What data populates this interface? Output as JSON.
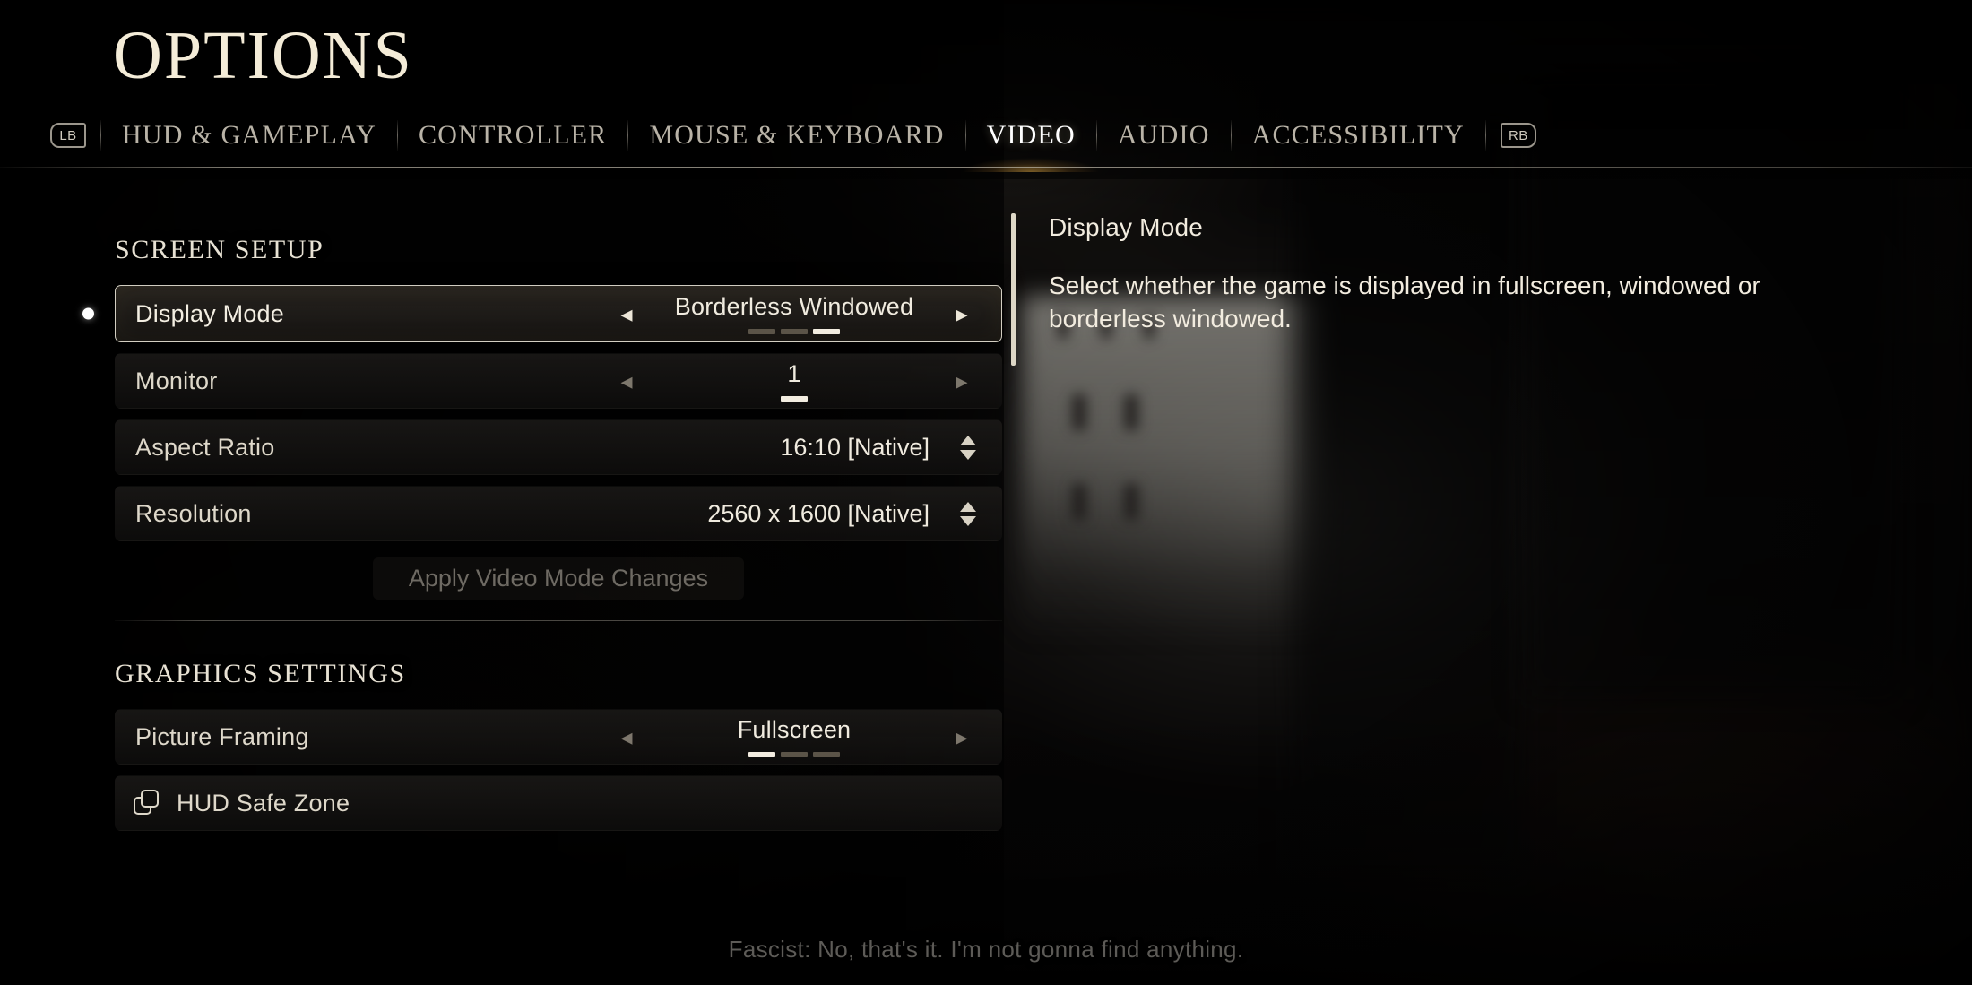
{
  "header": {
    "title": "OPTIONS",
    "bumper_left": "LB",
    "bumper_right": "RB",
    "tabs": [
      {
        "label": "HUD & GAMEPLAY",
        "active": false
      },
      {
        "label": "CONTROLLER",
        "active": false
      },
      {
        "label": "MOUSE & KEYBOARD",
        "active": false
      },
      {
        "label": "VIDEO",
        "active": true
      },
      {
        "label": "AUDIO",
        "active": false
      },
      {
        "label": "ACCESSIBILITY",
        "active": false
      }
    ]
  },
  "sections": {
    "screen_setup": {
      "title": "SCREEN SETUP",
      "rows": {
        "display_mode": {
          "label": "Display Mode",
          "value": "Borderless Windowed",
          "option_count": 3,
          "option_index": 3,
          "left_caret": "◂",
          "right_caret": "▸"
        },
        "monitor": {
          "label": "Monitor",
          "value": "1",
          "option_count": 1,
          "option_index": 1,
          "left_caret": "◂",
          "right_caret": "▸"
        },
        "aspect_ratio": {
          "label": "Aspect Ratio",
          "value": "16:10 [Native]"
        },
        "resolution": {
          "label": "Resolution",
          "value": "2560 x 1600 [Native]"
        }
      },
      "apply_label": "Apply Video Mode Changes"
    },
    "graphics_settings": {
      "title": "GRAPHICS SETTINGS",
      "rows": {
        "picture_framing": {
          "label": "Picture Framing",
          "value": "Fullscreen",
          "option_count": 3,
          "option_index": 1,
          "left_caret": "◂",
          "right_caret": "▸"
        },
        "hud_safe_zone": {
          "label": "HUD Safe Zone"
        }
      }
    }
  },
  "description": {
    "title": "Display Mode",
    "body": "Select whether the game is displayed in fullscreen, windowed or borderless windowed."
  },
  "subtitle": "Fascist: No, that's it. I'm not gonna find anything.",
  "colors": {
    "accent_cream": "#f2ecdf",
    "muted": "#7d776c",
    "tab_glow": "#d6a040",
    "disabled": "#6e6a63"
  }
}
